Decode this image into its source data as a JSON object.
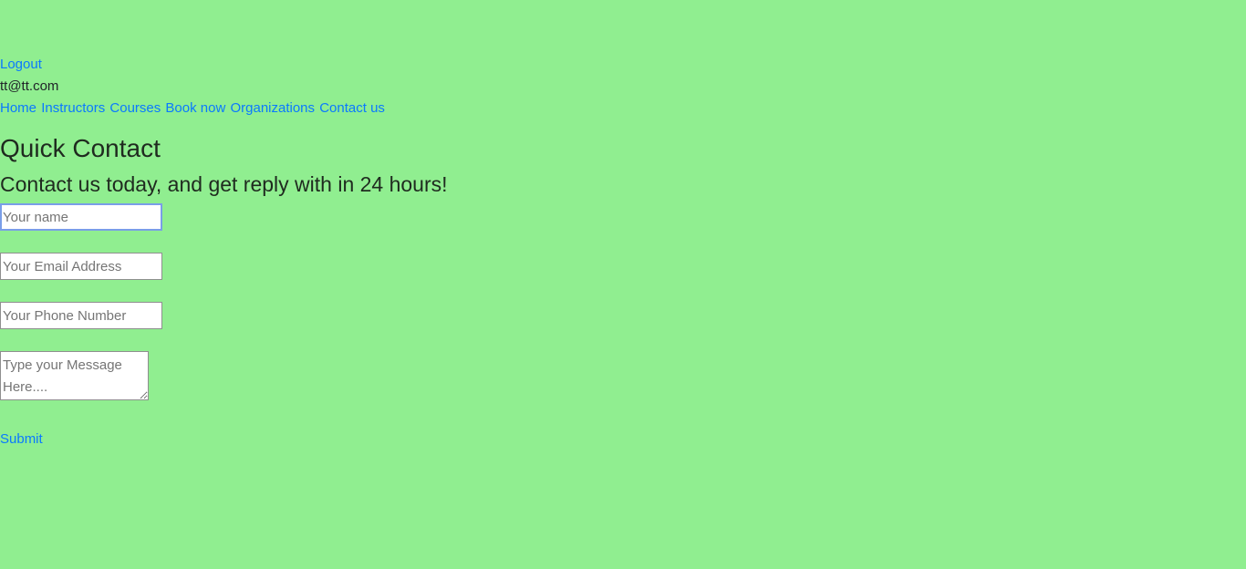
{
  "header": {
    "logout_label": "Logout",
    "user_email": "tt@tt.com"
  },
  "nav": {
    "items": [
      {
        "label": "Home"
      },
      {
        "label": "Instructors"
      },
      {
        "label": "Courses"
      },
      {
        "label": "Book now"
      },
      {
        "label": "Organizations"
      },
      {
        "label": "Contact us"
      }
    ]
  },
  "contact": {
    "title": "Quick Contact",
    "subtitle": "Contact us today, and get reply with in 24 hours!",
    "name_placeholder": "Your name",
    "name_value": "",
    "email_placeholder": "Your Email Address",
    "email_value": "",
    "phone_placeholder": "Your Phone Number",
    "phone_value": "",
    "message_placeholder": "Type your Message Here....",
    "message_value": "",
    "submit_label": "Submit"
  },
  "colors": {
    "background": "#90ee90",
    "link": "#0a79ff",
    "focus_ring": "#7a9ee8"
  }
}
